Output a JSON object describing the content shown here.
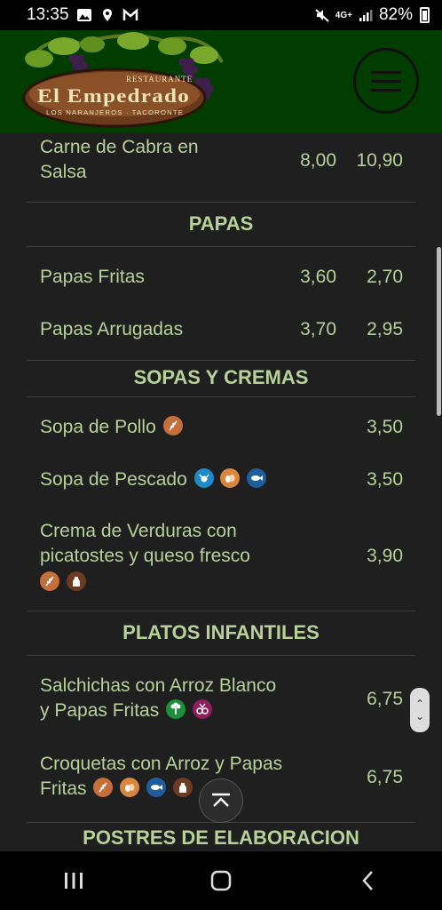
{
  "status_bar": {
    "time": "13:35",
    "network": "4G+",
    "battery": "82%",
    "left_icons": [
      "image-icon",
      "location-pin-icon",
      "gmail-icon"
    ],
    "right_icons": [
      "mute-icon",
      "signal-icon",
      "battery-icon"
    ]
  },
  "header": {
    "logo": {
      "line1": "RESTAURANTE",
      "line2": "El Empedrado",
      "line3": "LOS NARANJEROS · TACORONTE"
    },
    "menu_icon": "hamburger-icon"
  },
  "menu": {
    "top_item": {
      "name_line1": "Carne de Cabra en",
      "name_line2": "Salsa",
      "price1": "8,00",
      "price2": "10,90"
    },
    "sections": [
      {
        "title": "PAPAS",
        "items": [
          {
            "name": "Papas Fritas",
            "price1": "3,60",
            "price2": "2,70"
          },
          {
            "name": "Papas Arrugadas",
            "price1": "3,70",
            "price2": "2,95"
          }
        ]
      },
      {
        "title": "SOPAS Y CREMAS",
        "items": [
          {
            "name": "Sopa de Pollo",
            "price": "3,50",
            "allergens": [
              "gluten-icon"
            ]
          },
          {
            "name": "Sopa de Pescado",
            "price": "3,50",
            "allergens": [
              "crustacean-icon",
              "egg-icon",
              "fish-icon"
            ]
          },
          {
            "name_line1": "Crema de Verduras con",
            "name_line2": "picatostes y queso fresco",
            "price": "3,90",
            "allergens": [
              "gluten-icon",
              "milk-icon"
            ]
          }
        ]
      },
      {
        "title": "PLATOS INFANTILES",
        "items": [
          {
            "name_line1": "Salchichas con Arroz Blanco",
            "name_line2": "y Papas Fritas",
            "price": "6,75",
            "allergens": [
              "celery-icon",
              "sulphite-icon"
            ]
          },
          {
            "name_line1": "Croquetas con Arroz y Papas",
            "name_line2": "Fritas",
            "price": "6,75",
            "allergens": [
              "gluten-icon",
              "egg-icon",
              "fish-icon",
              "milk-icon"
            ]
          }
        ]
      },
      {
        "title": "POSTRES DE ELABORACION"
      }
    ]
  },
  "colors": {
    "header_bg": "#023d00",
    "page_bg": "#1f1f1f",
    "text_green": "#b7d197"
  }
}
